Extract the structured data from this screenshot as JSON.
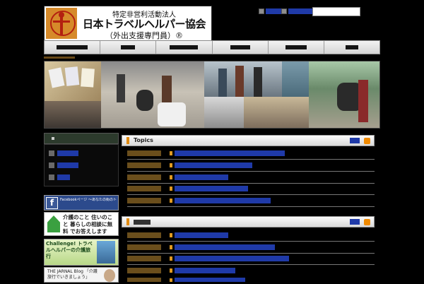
{
  "logo": {
    "line1": "特定非営利活動法人",
    "line2": "日本トラベルヘルパー協会",
    "line3": "（外出支援専門員）®"
  },
  "header": {
    "buttons": [
      {
        "icon": "link-icon"
      },
      {
        "icon": "link-icon"
      }
    ],
    "search": {
      "value": "",
      "placeholder": ""
    }
  },
  "nav": {
    "item_count": 6
  },
  "topics": {
    "title": "Topics",
    "rows": 5
  },
  "second_section": {
    "rows": 5
  },
  "side_banners": [
    {
      "name": "facebook-banner",
      "text": "Facebookページ ～あなたの街のトラベルヘルパー～"
    },
    {
      "name": "consult-banner",
      "text": "介護のこと 住いのこと 暮らしの相談に無料 でお答えします"
    },
    {
      "name": "challenge-banner",
      "text": "Challenge! トラベルヘルパーの介護旅行"
    },
    {
      "name": "blog-banner",
      "text": "THE JARNAL Blog 「介護旅行でいきましょう」"
    }
  ],
  "colors": {
    "link": "#1f3aa8",
    "date": "#6a4e1c",
    "accent": "#e08a10",
    "background": "#000000"
  }
}
